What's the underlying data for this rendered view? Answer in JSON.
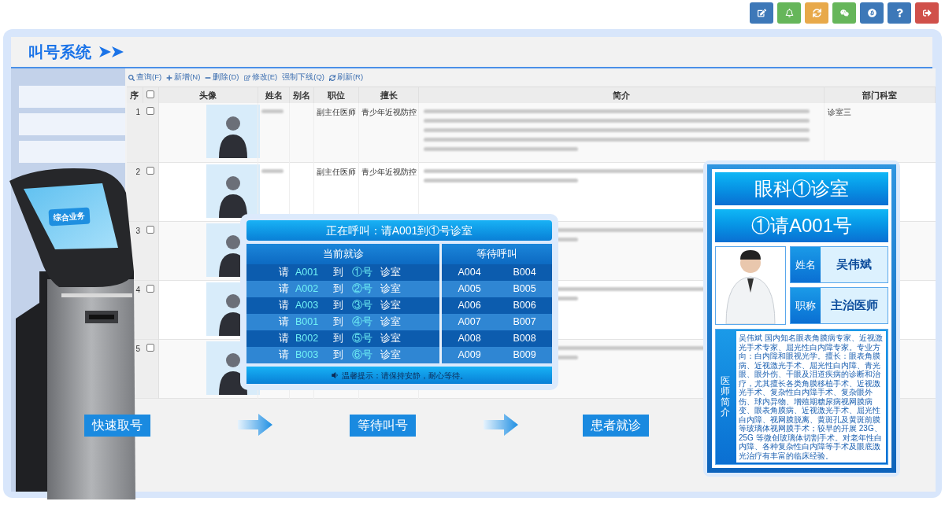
{
  "top_buttons": [
    {
      "color": "#3d78b8"
    },
    {
      "color": "#66b65a"
    },
    {
      "color": "#e8a94a"
    },
    {
      "color": "#66b65a"
    },
    {
      "color": "#3d78b8"
    },
    {
      "color": "#3d78b8"
    },
    {
      "color": "#d0504a"
    }
  ],
  "app": {
    "title": "叫号系统",
    "toolbar": [
      {
        "label": "查询(F)"
      },
      {
        "label": "新增(N)"
      },
      {
        "label": "删除(D)"
      },
      {
        "label": "修改(E)"
      },
      {
        "label": "强制下线(Q)"
      },
      {
        "label": "刷新(R)"
      }
    ],
    "columns": [
      "序",
      "头像",
      "姓名",
      "别名",
      "职位",
      "擅长",
      "简介",
      "部门科室"
    ],
    "header_checked": false,
    "rows": [
      {
        "index": "1",
        "checked": false,
        "position": "副主任医师",
        "specialty": "青少年近视防控",
        "department": "诊室三"
      },
      {
        "index": "2",
        "checked": false,
        "position": "副主任医师",
        "specialty": "青少年近视防控"
      },
      {
        "index": "3",
        "checked": false
      },
      {
        "index": "4",
        "checked": false
      },
      {
        "index": "5",
        "checked": false
      }
    ]
  },
  "kiosk": {
    "screen_label": "综合业务"
  },
  "steps": [
    "快速取号",
    "等待叫号",
    "患者就诊"
  ],
  "call_panel": {
    "now_calling": "正在呼叫：请A001到①号诊室",
    "current_header": "当前就诊",
    "waiting_header": "等待呼叫",
    "current": [
      {
        "prefix": "请",
        "ticket": "A001",
        "to": "到",
        "room": "①号",
        "suffix": "诊室"
      },
      {
        "prefix": "请",
        "ticket": "A002",
        "to": "到",
        "room": "②号",
        "suffix": "诊室"
      },
      {
        "prefix": "请",
        "ticket": "A003",
        "to": "到",
        "room": "③号",
        "suffix": "诊室"
      },
      {
        "prefix": "请",
        "ticket": "B001",
        "to": "到",
        "room": "④号",
        "suffix": "诊室"
      },
      {
        "prefix": "请",
        "ticket": "B002",
        "to": "到",
        "room": "⑤号",
        "suffix": "诊室"
      },
      {
        "prefix": "请",
        "ticket": "B003",
        "to": "到",
        "room": "⑥号",
        "suffix": "诊室"
      }
    ],
    "waiting": [
      {
        "a": "A004",
        "b": "B004"
      },
      {
        "a": "A005",
        "b": "B005"
      },
      {
        "a": "A006",
        "b": "B006"
      },
      {
        "a": "A007",
        "b": "B007"
      },
      {
        "a": "A008",
        "b": "B008"
      },
      {
        "a": "A009",
        "b": "B009"
      }
    ],
    "tip": "温馨提示：请保持安静，耐心等待。"
  },
  "doctor_panel": {
    "room": "眼科①诊室",
    "call": "①请A001号",
    "name_label": "姓名",
    "name": "吴伟斌",
    "title_label": "职称",
    "title": "主治医师",
    "intro_label": "医师简介",
    "intro": "吴伟斌 国内知名眼表角膜病专家、近视激光手术专家、屈光性白内障专家。专业方向：白内障和眼视光学。擅长：眼表角膜病、近视激光手术、屈光性白内障、青光眼、眼外伤、干眼及泪道疾病的诊断和治疗，尤其擅长各类角膜移植手术、近视激光手术、复杂性白内障手术、复杂眼外伤、球内异物、增殖期糖尿病视网膜病变、眼表角膜病、近视激光手术、屈光性白内障、视网膜脱离、黄斑孔及黄斑前膜等玻璃体视网膜手术；较早的开展 23G、25G 等微创玻璃体切割手术。对老年性白内障、各种复杂性白内障等手术及眼底激光治疗有丰富的临床经验。"
  }
}
